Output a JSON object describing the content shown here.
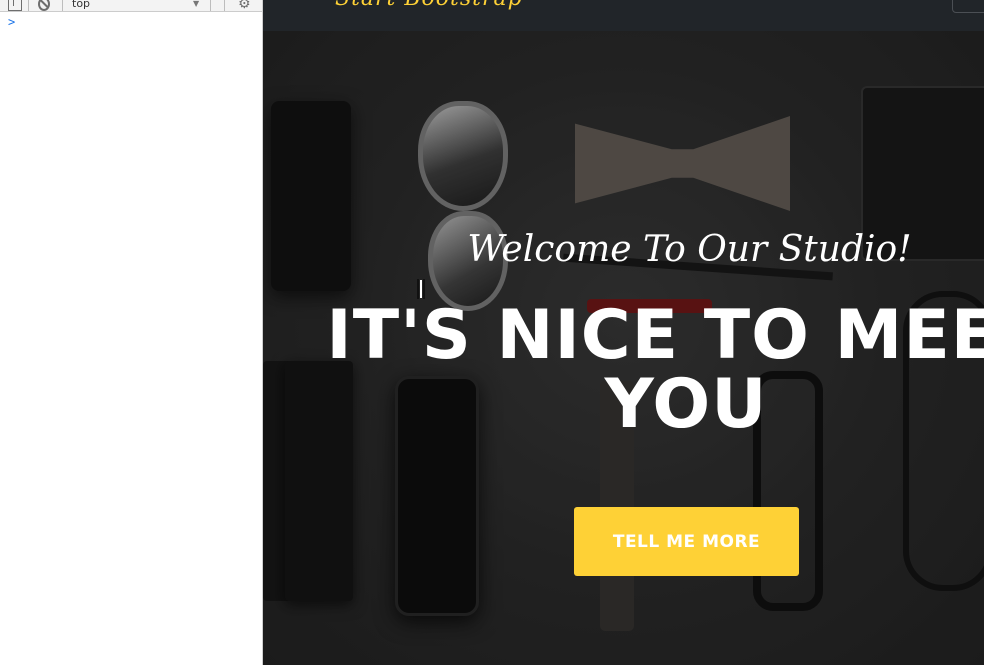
{
  "devtools": {
    "context": "top",
    "prompt_symbol": ">",
    "icons": [
      "panel-toggle-icon",
      "clear-console-icon",
      "chevron-down-icon",
      "gear-icon"
    ]
  },
  "navbar": {
    "brand": "Start Bootstrap"
  },
  "hero": {
    "subheading": "Welcome To Our Studio!",
    "heading": "IT'S NICE TO MEET YOU",
    "button_label": "TELL ME MORE"
  },
  "colors": {
    "accent": "#fed136",
    "navbar_bg": "#212529",
    "text": "#ffffff"
  }
}
